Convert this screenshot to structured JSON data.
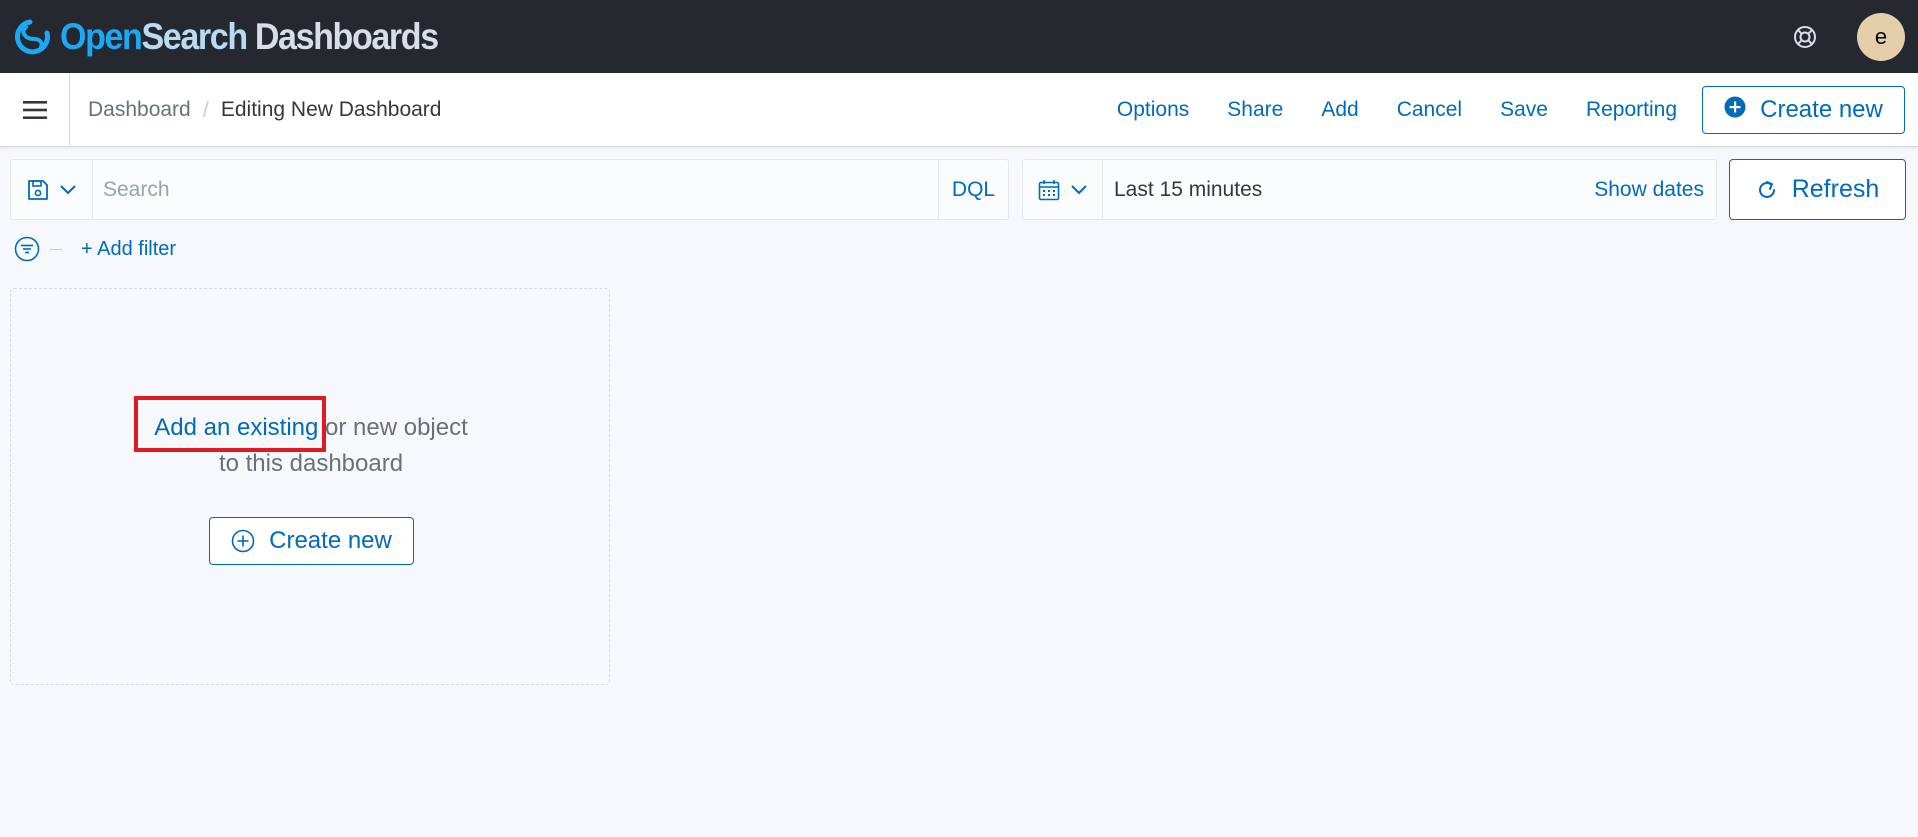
{
  "header": {
    "logo_open": "Open",
    "logo_search": "Search",
    "logo_dashboards": " Dashboards",
    "avatar_initial": "e",
    "help_icon": "help-lifebuoy-icon"
  },
  "appbar": {
    "breadcrumb_root": "Dashboard",
    "breadcrumb_separator": "/",
    "breadcrumb_current": "Editing New Dashboard",
    "menu": {
      "options": "Options",
      "share": "Share",
      "add": "Add",
      "cancel": "Cancel",
      "save": "Save",
      "reporting": "Reporting"
    },
    "create_new": "Create new"
  },
  "query_bar": {
    "search_placeholder": "Search",
    "search_value": "",
    "language": "DQL",
    "time_range": "Last 15 minutes",
    "show_dates": "Show dates",
    "refresh": "Refresh"
  },
  "filter_bar": {
    "add_filter": "+ Add filter"
  },
  "empty_panel": {
    "link_text": "Add an existing",
    "text_rest": " or new object",
    "text_line2": "to this dashboard",
    "create_new": "Create new"
  },
  "colors": {
    "header_bg": "#25282f",
    "accent": "#006bb8",
    "page_bg": "#f7f8fc",
    "highlight": "#e01a22",
    "avatar_bg": "#e4cfa9"
  }
}
